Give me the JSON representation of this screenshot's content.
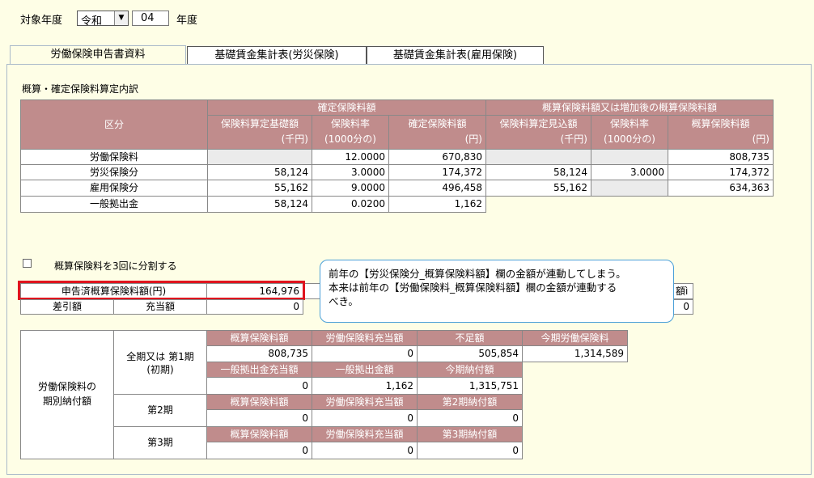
{
  "year": {
    "label": "対象年度",
    "era": "令和",
    "value": "04",
    "unit": "年度"
  },
  "tabs": [
    "労働保険申告書資料",
    "基礎賃金集計表(労災保険)",
    "基礎賃金集計表(雇用保険)"
  ],
  "section_title": "概算・確定保険料算定内訳",
  "table": {
    "category_header": "区分",
    "group1": "確定保険料額",
    "group2": "概算保険料額又は増加後の概算保険料額",
    "col_base": "保険料算定基礎額",
    "unit_thousand": "(千円)",
    "col_rate": "保険料率",
    "unit_per_mille": "(1000分の)",
    "col_confirmed": "確定保険料額",
    "unit_yen": "(円)",
    "col_est_base": "保険料算定見込額",
    "col_estimated": "概算保険料額",
    "rows": [
      {
        "label": "労働保険料",
        "base": "",
        "rate": "12.0000",
        "confirmed": "670,830",
        "est_base": "",
        "est_rate": "",
        "estimated": "808,735"
      },
      {
        "label": "労災保険分",
        "base": "58,124",
        "rate": "3.0000",
        "confirmed": "174,372",
        "est_base": "58,124",
        "est_rate": "3.0000",
        "estimated": "174,372"
      },
      {
        "label": "雇用保険分",
        "base": "55,162",
        "rate": "9.0000",
        "confirmed": "496,458",
        "est_base": "55,162",
        "est_rate": "",
        "estimated": "634,363"
      },
      {
        "label": "一般拠出金",
        "base": "58,124",
        "rate": "0.0200",
        "confirmed": "1,162"
      }
    ]
  },
  "split_checkbox_label": "概算保険料を3回に分割する",
  "declared": {
    "label": "申告済概算保険料額(円)",
    "value": "164,976",
    "right_partial_label": "額ì",
    "right_value": "0"
  },
  "diff": {
    "label": "差引額",
    "sub_label": "充当額",
    "value": "0"
  },
  "tooltip": {
    "line1": "前年の【労災保険分_概算保険料額】欄の金額が連動してしまう。",
    "line2": "本来は前年の【労働保険料_概算保険料額】欄の金額が連動する",
    "line3": "べき。"
  },
  "installments": {
    "title_line1": "労働保険料の",
    "title_line2": "期別納付額",
    "period1_line1": "全期又は 第1期",
    "period1_line2": "(初期)",
    "period2": "第2期",
    "period3": "第3期",
    "h_estimated": "概算保険料額",
    "h_applied": "労働保険料充当額",
    "h_shortfall": "不足額",
    "h_current": "今期労働保険料",
    "h_general_applied": "一般拠出金充当額",
    "h_general": "一般拠出金額",
    "h_due": "今期納付額",
    "h_p2_due": "第2期納付額",
    "h_p3_due": "第3期納付額",
    "p1": {
      "estimated": "808,735",
      "applied": "0",
      "shortfall": "505,854",
      "current": "1,314,589",
      "general_applied": "0",
      "general": "1,162",
      "due": "1,315,751"
    },
    "p2": {
      "estimated": "0",
      "applied": "0",
      "due": "0"
    },
    "p3": {
      "estimated": "0",
      "applied": "0",
      "due": "0"
    }
  }
}
